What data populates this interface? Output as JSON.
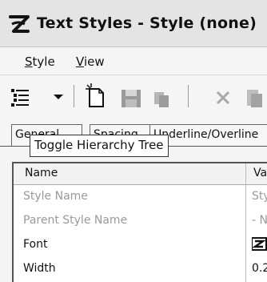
{
  "window": {
    "title": "Text Styles - Style (none)"
  },
  "menu": {
    "items": [
      {
        "label": "Style",
        "accel": "S",
        "rest": "tyle"
      },
      {
        "label": "View",
        "accel": "V",
        "rest": "iew"
      }
    ]
  },
  "toolbar": {
    "buttons": [
      {
        "icon": "hierarchy-tree-icon"
      },
      {
        "icon": "dropdown-arrow-icon"
      },
      {
        "icon": "new-document-icon"
      },
      {
        "icon": "save-icon"
      },
      {
        "icon": "copy-icon"
      },
      {
        "icon": "delete-icon"
      },
      {
        "icon": "paste-icon"
      }
    ]
  },
  "tooltip": "Toggle Hierarchy Tree",
  "tabs": [
    {
      "label": "General"
    },
    {
      "label": "Spacing"
    },
    {
      "label": "Underline/Overline"
    }
  ],
  "table": {
    "columns": [
      "Name",
      "Value"
    ],
    "rows": [
      {
        "name": "Style Name",
        "value": "Style",
        "disabled": true
      },
      {
        "name": "Parent Style Name",
        "value": "- N",
        "disabled": true
      },
      {
        "name": "Font",
        "value": "",
        "value_icon": "font-glyph-icon",
        "disabled": false
      },
      {
        "name": "Width",
        "value": "0.2",
        "disabled": false
      }
    ]
  }
}
